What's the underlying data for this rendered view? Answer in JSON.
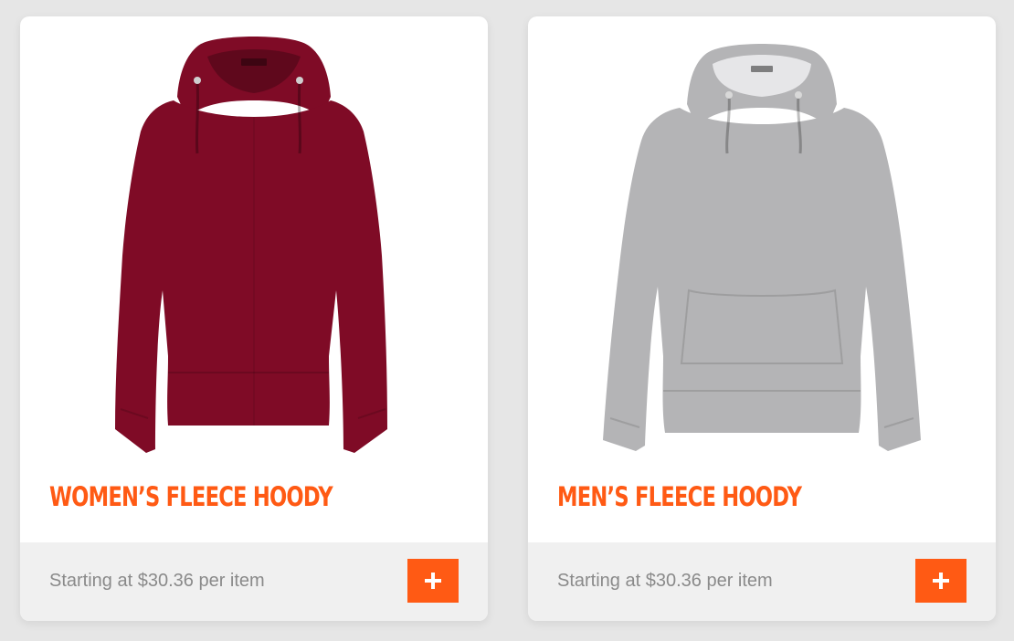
{
  "theme": {
    "accent": "#ff5a14",
    "price_color": "#8a8a8a"
  },
  "products": [
    {
      "title": "Women’s Fleece Hoody",
      "price_text": "Starting at $30.36 per item",
      "image": "maroon-hoodie-image",
      "garment_color": "#7f0b26",
      "add_icon": "plus-icon"
    },
    {
      "title": "Men’s Fleece Hoody",
      "price_text": "Starting at $30.36 per item",
      "image": "grey-hoodie-image",
      "garment_color": "#b4b4b6",
      "add_icon": "plus-icon"
    }
  ]
}
